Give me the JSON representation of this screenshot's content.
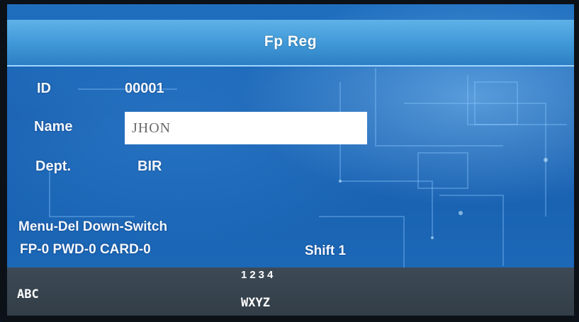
{
  "screen": {
    "title": "Fp Reg"
  },
  "form": {
    "id_label": "ID",
    "id_value": "00001",
    "name_label": "Name",
    "name_value": "JHON",
    "dept_label": "Dept.",
    "dept_value": "BIR"
  },
  "hints": {
    "keys": "Menu-Del Down-Switch",
    "counts": "FP-0 PWD-0 CARD-0",
    "shift": "Shift 1"
  },
  "input_method": {
    "digits": "1234",
    "mode": "ABC",
    "letters": "WXYZ"
  },
  "colors": {
    "screen_blue": "#1a5fae",
    "titlebar_blue": "#3f97d6",
    "input_strip": "#323d47",
    "text": "#ffffff"
  }
}
